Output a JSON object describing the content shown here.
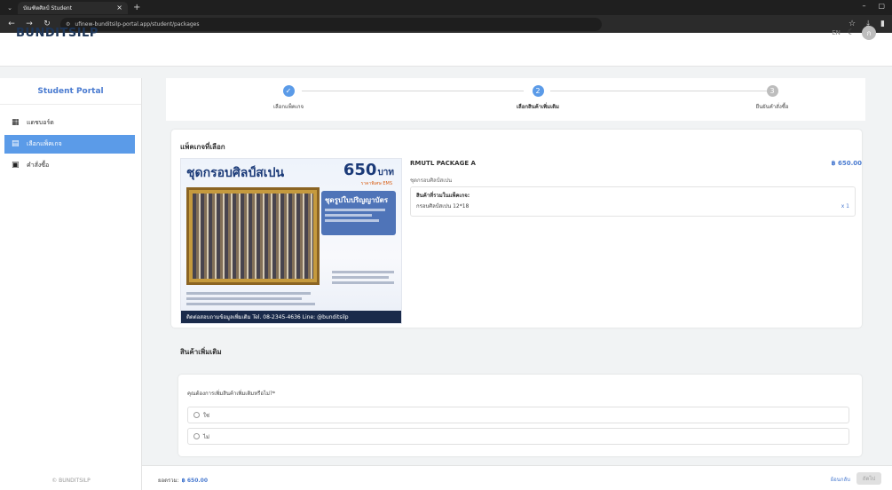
{
  "browser": {
    "tab_title": "บัณฑิตศิลป์ Student",
    "tab_close": "×",
    "new_tab": "+",
    "url": "ufinew-bunditsilp-portal.app/student/packages",
    "window_controls": [
      "–",
      "▢"
    ]
  },
  "header": {
    "brand": "BUNDITSILP",
    "lang": "EN",
    "avatar_initial": "ก"
  },
  "sidebar": {
    "title": "Student Portal",
    "items": [
      {
        "label": "แดชบอร์ด",
        "icon": "dashboard-icon",
        "active": false
      },
      {
        "label": "เลือกแพ็คเกจ",
        "icon": "package-icon",
        "active": true
      },
      {
        "label": "คำสั่งซื้อ",
        "icon": "orders-icon",
        "active": false
      }
    ],
    "footer": "© BUNDITSILP"
  },
  "stepper": {
    "steps": [
      {
        "label": "เลือกแพ็คเกจ",
        "state": "done",
        "mark": "✓"
      },
      {
        "label": "เลือกสินค้าเพิ่มเติม",
        "state": "current",
        "mark": "2"
      },
      {
        "label": "ยืนยันคำสั่งซื้อ",
        "state": "todo",
        "mark": "3"
      }
    ]
  },
  "package": {
    "section_title": "แพ็คเกจที่เลือก",
    "poster_title": "ชุดกรอบศิลป์สเปน",
    "poster_price": "650",
    "poster_price_unit": "บาท",
    "poster_price_sub": "ราคาพิเศษ EMS",
    "poster_box_title": "ชุดรูปใบปริญญาบัตร",
    "poster_footer": "ติดต่อสอบถามข้อมูลเพิ่มเติม Tel. 08-2345-4636   Line: @bunditsilp",
    "name": "RMUTL PACKAGE A",
    "price": "฿ 650.00",
    "subtitle": "ชุดกรอบศิลป์สเปน",
    "items_header": "สินค้าที่รวมในแพ็คเกจ:",
    "item_name": "กรอบศิลป์สเปน 12*18",
    "item_qty": "x 1"
  },
  "addons": {
    "section_title": "สินค้าเพิ่มเติม",
    "question": "คุณต้องการเพิ่มสินค้าเพิ่มเติมหรือไม่?*",
    "options": [
      "ใช่",
      "ไม่"
    ]
  },
  "footer_bar": {
    "total_label": "ยอดรวม:",
    "total_amount": "฿ 650.00",
    "back": "ย้อนกลับ",
    "next": "ถัดไป"
  },
  "colors": {
    "accent": "#5b9be8",
    "brand": "#1d3557",
    "price": "#4a7bd0"
  }
}
